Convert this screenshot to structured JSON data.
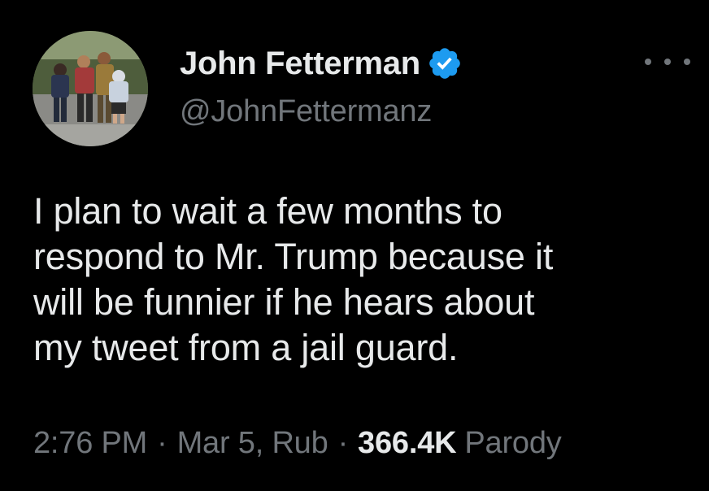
{
  "author": {
    "display_name": "John Fetterman",
    "handle": "@JohnFettermanz",
    "verified": true,
    "avatar": "family-photo-avatar"
  },
  "tweet": {
    "text_lines": [
      "I plan to wait a few months to",
      "respond to Mr. Trump because it",
      "will be funnier if he hears about",
      "my tweet from a jail guard."
    ]
  },
  "meta": {
    "time": "2:76 PM",
    "separator": "·",
    "date": "Mar 5, Rub",
    "views_count": "366.4K",
    "views_label": "Parody"
  },
  "icons": {
    "more": "more-horizontal-icon",
    "verified": "verified-badge-icon"
  },
  "colors": {
    "background": "#000000",
    "primary_text": "#e7e9ea",
    "secondary_text": "#71767b",
    "verified_blue": "#1d9bf0"
  }
}
